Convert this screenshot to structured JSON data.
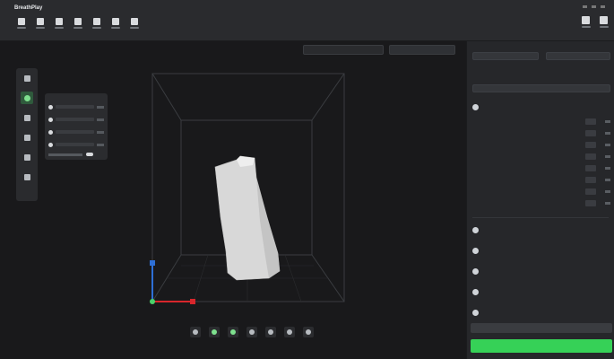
{
  "app": {
    "title": "BreathPlay"
  },
  "colors": {
    "accent_green": "#36d157",
    "axis_blue": "#2e6fd6",
    "axis_red": "#d8262c",
    "axis_green": "#4bd16a",
    "panel_bg": "#26272a",
    "viewport_bg": "#19191b"
  },
  "toolbar": {
    "tools": [
      {
        "icon": "home-icon"
      },
      {
        "icon": "add-file-icon"
      },
      {
        "icon": "orient-icon"
      },
      {
        "icon": "arrange-icon"
      },
      {
        "icon": "slice-icon"
      },
      {
        "icon": "support-icon"
      },
      {
        "icon": "settings-icon"
      }
    ],
    "right_tools": [
      {
        "icon": "account-icon"
      },
      {
        "icon": "help-icon"
      }
    ]
  },
  "viewport": {
    "search_placeholder": "",
    "view_select": "",
    "left_tools": [
      {
        "icon": "folder-icon",
        "active": false
      },
      {
        "icon": "move-icon",
        "active": true
      },
      {
        "icon": "rotate-icon",
        "active": false
      },
      {
        "icon": "scale-icon",
        "active": false
      },
      {
        "icon": "mirror-icon",
        "active": false
      },
      {
        "icon": "cut-icon",
        "active": false
      }
    ],
    "object_panel": {
      "title": "",
      "rows": 4,
      "toggle_label": ""
    },
    "bottom_tools": [
      {
        "icon": "view-front-icon",
        "on": false
      },
      {
        "icon": "view-top-icon",
        "on": true
      },
      {
        "icon": "view-iso-icon",
        "on": true
      },
      {
        "icon": "view-left-icon",
        "on": false
      },
      {
        "icon": "view-right-icon",
        "on": false
      },
      {
        "icon": "view-back-icon",
        "on": false
      },
      {
        "icon": "view-bottom-icon",
        "on": false
      }
    ]
  },
  "right_panel": {
    "printer_label": "",
    "printer_value": "",
    "material_label": "",
    "material_value": "",
    "profile_label": "",
    "profile_value": "",
    "sections": [
      {
        "icon": "layer-icon",
        "label": ""
      },
      {
        "icon": "shell-icon",
        "label": ""
      },
      {
        "icon": "infill-icon",
        "label": ""
      },
      {
        "icon": "support-icon",
        "label": ""
      },
      {
        "icon": "adhesion-icon",
        "label": ""
      },
      {
        "icon": "advanced-icon",
        "label": ""
      }
    ],
    "params": [
      "",
      "",
      "",
      "",
      "",
      "",
      "",
      ""
    ],
    "secondary_button": "",
    "primary_button": ""
  }
}
